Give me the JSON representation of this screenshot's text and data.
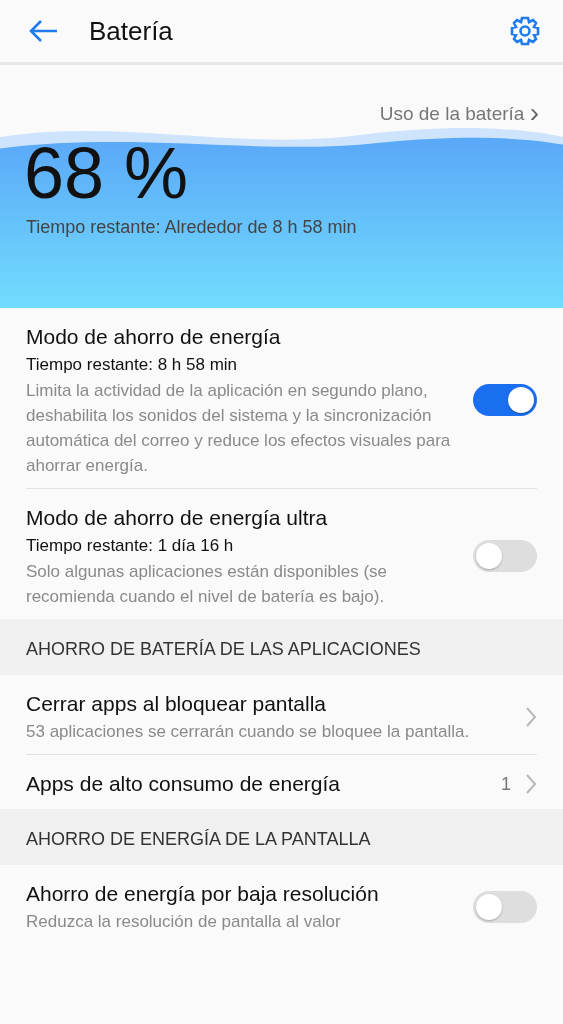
{
  "header": {
    "title": "Batería"
  },
  "battery": {
    "usage_link": "Uso de la batería",
    "chevron": "›",
    "percent": "68 %",
    "remaining": "Tiempo restante: Alrededor de 8 h 58 min"
  },
  "list": [
    {
      "kind": "toggle",
      "title": "Modo de ahorro de energía",
      "subtitle": "Tiempo restante: 8 h 58 min",
      "description": "Limita la actividad de la aplicación en segundo plano, deshabilita los sonidos del sistema y la sincronización automática del correo y reduce los efectos visuales para ahorrar energía.",
      "on": true
    },
    {
      "kind": "toggle",
      "title": "Modo de ahorro de energía ultra",
      "subtitle": "Tiempo restante: 1 día 16 h",
      "description": "Solo algunas aplicaciones están disponibles (se recomienda cuando el nivel de batería es bajo).",
      "on": false
    },
    {
      "kind": "header",
      "title": "AHORRO DE BATERÍA DE LAS APLICACIONES"
    },
    {
      "kind": "nav",
      "title": "Cerrar apps al bloquear pantalla",
      "description": "53 aplicaciones se cerrarán cuando se bloquee la pantalla."
    },
    {
      "kind": "nav",
      "title": "Apps de alto consumo de energía",
      "value": "1"
    },
    {
      "kind": "header",
      "title": "AHORRO DE ENERGÍA DE LA PANTALLA"
    },
    {
      "kind": "toggle",
      "title": "Ahorro de energía por baja resolución",
      "description": "Reduzca la resolución de pantalla al valor",
      "on": false
    }
  ]
}
